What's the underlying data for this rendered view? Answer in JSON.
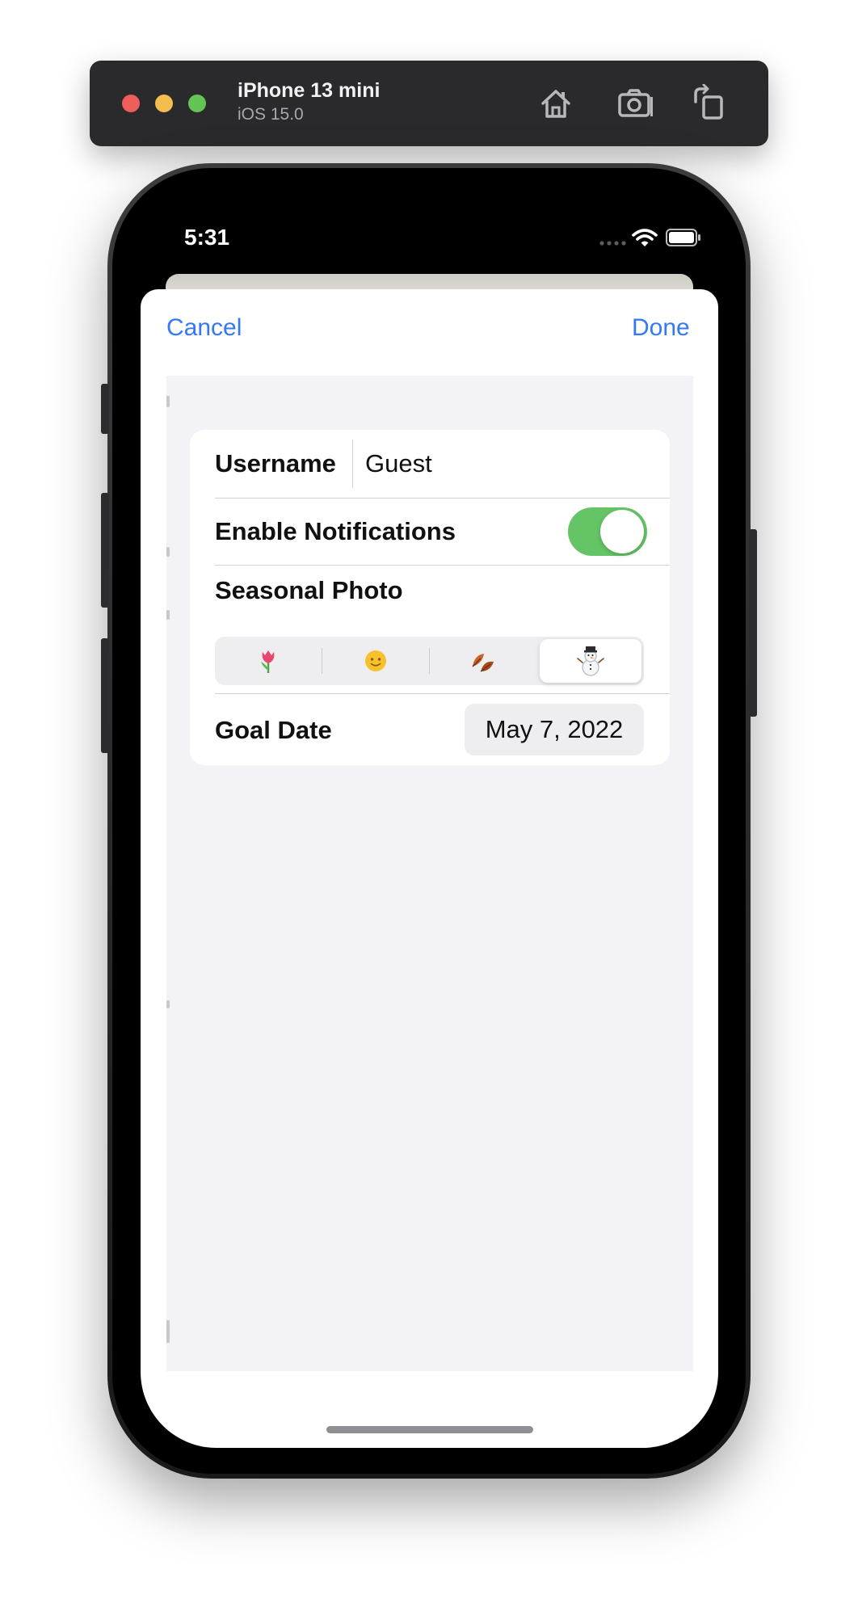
{
  "simulator": {
    "device_name": "iPhone 13 mini",
    "os_version": "iOS 15.0",
    "icons": [
      "home-icon",
      "screenshot-icon",
      "rotate-icon"
    ],
    "traffic_colors": {
      "close": "#ff5f57",
      "minimize": "#febc2e",
      "zoom": "#28c840"
    }
  },
  "status_bar": {
    "time": "5:31",
    "icons": [
      "wifi-icon",
      "battery-icon"
    ]
  },
  "sheet": {
    "cancel_label": "Cancel",
    "done_label": "Done",
    "accent_color": "#3478f6"
  },
  "form": {
    "username": {
      "label": "Username",
      "value": "Guest"
    },
    "notifications": {
      "label": "Enable Notifications",
      "enabled": true,
      "on_color": "#65c466"
    },
    "seasonal_photo": {
      "label": "Seasonal Photo",
      "options": [
        "🌷",
        "🌞",
        "🍂",
        "☃️"
      ],
      "selected_index": 3
    },
    "goal_date": {
      "label": "Goal Date",
      "value": "May 7, 2022"
    }
  }
}
